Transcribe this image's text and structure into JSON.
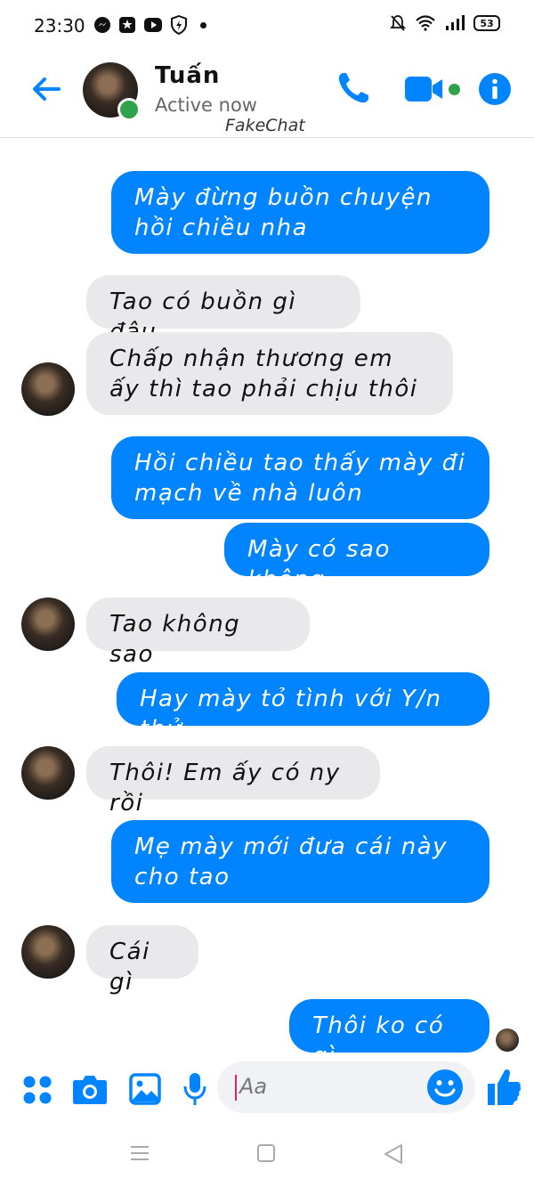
{
  "status_bar": {
    "time": "23:30",
    "left_icons": [
      "messenger-icon",
      "app-icon",
      "youtube-icon",
      "shield-icon"
    ],
    "right_icons": [
      "mute-icon",
      "wifi-icon",
      "signal-icon"
    ],
    "battery": "53"
  },
  "header": {
    "contact_name": "Tuấn",
    "status": "Active now",
    "watermark": "FakeChat",
    "accent": "#0084ff",
    "online_color": "#31a24c"
  },
  "messages": [
    {
      "side": "sent",
      "text": "Mày đừng buồn chuyện hồi chiều nha"
    },
    {
      "side": "received",
      "text": "Tao có buồn gì đâu"
    },
    {
      "side": "received",
      "text": "Chấp nhận thương em ấy thì tao phải chịu thôi"
    },
    {
      "side": "sent",
      "text": "Hồi chiều tao thấy mày đi mạch về nhà luôn"
    },
    {
      "side": "sent",
      "text": "Mày có sao không"
    },
    {
      "side": "received",
      "text": "Tao không sao"
    },
    {
      "side": "sent",
      "text": "Hay mày tỏ tình với Y/n thử"
    },
    {
      "side": "received",
      "text": "Thôi! Em ấy có ny rồi"
    },
    {
      "side": "sent",
      "text": "Mẹ mày mới đưa cái này cho tao"
    },
    {
      "side": "received",
      "text": "Cái gì"
    },
    {
      "side": "sent",
      "text": "Thôi ko có gì"
    }
  ],
  "composer": {
    "placeholder": "Aa",
    "icons": [
      "apps-icon",
      "camera-icon",
      "image-icon",
      "microphone-icon",
      "emoji-icon",
      "like-icon"
    ]
  },
  "nav_bar": [
    "menu-icon",
    "home-icon",
    "back-icon"
  ]
}
